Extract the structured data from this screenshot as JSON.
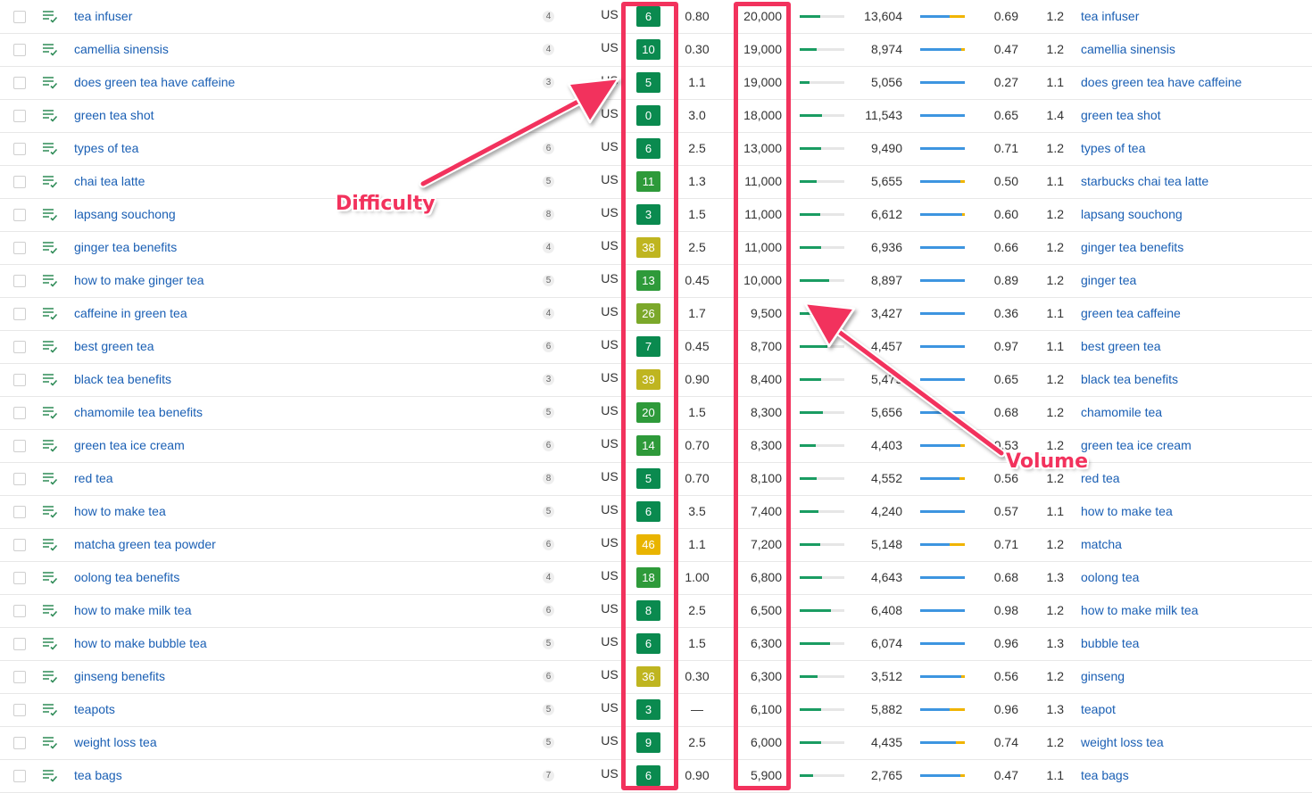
{
  "colors": {
    "link": "#1a5fb4",
    "annotation": "#f2325d",
    "kd_dark_green": "#0a8a4f",
    "kd_green": "#2e9a3a",
    "kd_light_green": "#7ba82a",
    "kd_olive": "#bfb520",
    "kd_yellow": "#e9b400",
    "volume_bar": "#1a9c62",
    "clicks_bar": "#3d95e0",
    "paid_clicks": "#f0b400"
  },
  "annotations": {
    "difficulty_label": "Difficulty",
    "volume_label": "Volume"
  },
  "rows": [
    {
      "keyword": "tea infuser",
      "sf": "4",
      "country": "US",
      "kd": "6",
      "kd_color": "#0a8a4f",
      "cpc": "0.80",
      "volume": "20,000",
      "vol_level": 0.45,
      "tp": "13,604",
      "paid_share": 0.35,
      "ctr": "0.69",
      "rr": "1.2",
      "parent": "tea infuser"
    },
    {
      "keyword": "camellia sinensis",
      "sf": "4",
      "country": "US",
      "kd": "10",
      "kd_color": "#0a8a4f",
      "cpc": "0.30",
      "volume": "19,000",
      "vol_level": 0.38,
      "tp": "8,974",
      "paid_share": 0.08,
      "ctr": "0.47",
      "rr": "1.2",
      "parent": "camellia sinensis"
    },
    {
      "keyword": "does green tea have caffeine",
      "sf": "3",
      "country": "US",
      "kd": "5",
      "kd_color": "#0a8a4f",
      "cpc": "1.1",
      "volume": "19,000",
      "vol_level": 0.22,
      "tp": "5,056",
      "paid_share": 0.0,
      "ctr": "0.27",
      "rr": "1.1",
      "parent": "does green tea have caffeine"
    },
    {
      "keyword": "green tea shot",
      "sf": "",
      "country": "US",
      "kd": "0",
      "kd_color": "#0a8a4f",
      "cpc": "3.0",
      "volume": "18,000",
      "vol_level": 0.5,
      "tp": "11,543",
      "paid_share": 0.0,
      "ctr": "0.65",
      "rr": "1.4",
      "parent": "green tea shot"
    },
    {
      "keyword": "types of tea",
      "sf": "6",
      "country": "US",
      "kd": "6",
      "kd_color": "#0a8a4f",
      "cpc": "2.5",
      "volume": "13,000",
      "vol_level": 0.48,
      "tp": "9,490",
      "paid_share": 0.0,
      "ctr": "0.71",
      "rr": "1.2",
      "parent": "types of tea"
    },
    {
      "keyword": "chai tea latte",
      "sf": "5",
      "country": "US",
      "kd": "11",
      "kd_color": "#2e9a3a",
      "cpc": "1.3",
      "volume": "11,000",
      "vol_level": 0.38,
      "tp": "5,655",
      "paid_share": 0.1,
      "ctr": "0.50",
      "rr": "1.1",
      "parent": "starbucks chai tea latte"
    },
    {
      "keyword": "lapsang souchong",
      "sf": "8",
      "country": "US",
      "kd": "3",
      "kd_color": "#0a8a4f",
      "cpc": "1.5",
      "volume": "11,000",
      "vol_level": 0.45,
      "tp": "6,612",
      "paid_share": 0.06,
      "ctr": "0.60",
      "rr": "1.2",
      "parent": "lapsang souchong"
    },
    {
      "keyword": "ginger tea benefits",
      "sf": "4",
      "country": "US",
      "kd": "38",
      "kd_color": "#bfb520",
      "cpc": "2.5",
      "volume": "11,000",
      "vol_level": 0.48,
      "tp": "6,936",
      "paid_share": 0.0,
      "ctr": "0.66",
      "rr": "1.2",
      "parent": "ginger tea benefits"
    },
    {
      "keyword": "how to make ginger tea",
      "sf": "5",
      "country": "US",
      "kd": "13",
      "kd_color": "#2e9a3a",
      "cpc": "0.45",
      "volume": "10,000",
      "vol_level": 0.66,
      "tp": "8,897",
      "paid_share": 0.0,
      "ctr": "0.89",
      "rr": "1.2",
      "parent": "ginger tea"
    },
    {
      "keyword": "caffeine in green tea",
      "sf": "4",
      "country": "US",
      "kd": "26",
      "kd_color": "#7ba82a",
      "cpc": "1.7",
      "volume": "9,500",
      "vol_level": 0.3,
      "tp": "3,427",
      "paid_share": 0.0,
      "ctr": "0.36",
      "rr": "1.1",
      "parent": "green tea caffeine"
    },
    {
      "keyword": "best green tea",
      "sf": "6",
      "country": "US",
      "kd": "7",
      "kd_color": "#0a8a4f",
      "cpc": "0.45",
      "volume": "8,700",
      "vol_level": 0.62,
      "tp": "4,457",
      "paid_share": 0.0,
      "ctr": "0.97",
      "rr": "1.1",
      "parent": "best green tea"
    },
    {
      "keyword": "black tea benefits",
      "sf": "3",
      "country": "US",
      "kd": "39",
      "kd_color": "#bfb520",
      "cpc": "0.90",
      "volume": "8,400",
      "vol_level": 0.48,
      "tp": "5,479",
      "paid_share": 0.0,
      "ctr": "0.65",
      "rr": "1.2",
      "parent": "black tea benefits"
    },
    {
      "keyword": "chamomile tea benefits",
      "sf": "5",
      "country": "US",
      "kd": "20",
      "kd_color": "#2e9a3a",
      "cpc": "1.5",
      "volume": "8,300",
      "vol_level": 0.52,
      "tp": "5,656",
      "paid_share": 0.0,
      "ctr": "0.68",
      "rr": "1.2",
      "parent": "chamomile tea"
    },
    {
      "keyword": "green tea ice cream",
      "sf": "6",
      "country": "US",
      "kd": "14",
      "kd_color": "#2e9a3a",
      "cpc": "0.70",
      "volume": "8,300",
      "vol_level": 0.36,
      "tp": "4,403",
      "paid_share": 0.1,
      "ctr": "0.53",
      "rr": "1.2",
      "parent": "green tea ice cream"
    },
    {
      "keyword": "red tea",
      "sf": "8",
      "country": "US",
      "kd": "5",
      "kd_color": "#0a8a4f",
      "cpc": "0.70",
      "volume": "8,100",
      "vol_level": 0.38,
      "tp": "4,552",
      "paid_share": 0.12,
      "ctr": "0.56",
      "rr": "1.2",
      "parent": "red tea"
    },
    {
      "keyword": "how to make tea",
      "sf": "5",
      "country": "US",
      "kd": "6",
      "kd_color": "#0a8a4f",
      "cpc": "3.5",
      "volume": "7,400",
      "vol_level": 0.42,
      "tp": "4,240",
      "paid_share": 0.0,
      "ctr": "0.57",
      "rr": "1.1",
      "parent": "how to make tea"
    },
    {
      "keyword": "matcha green tea powder",
      "sf": "6",
      "country": "US",
      "kd": "46",
      "kd_color": "#e9b400",
      "cpc": "1.1",
      "volume": "7,200",
      "vol_level": 0.46,
      "tp": "5,148",
      "paid_share": 0.35,
      "ctr": "0.71",
      "rr": "1.2",
      "parent": "matcha"
    },
    {
      "keyword": "oolong tea benefits",
      "sf": "4",
      "country": "US",
      "kd": "18",
      "kd_color": "#2e9a3a",
      "cpc": "1.00",
      "volume": "6,800",
      "vol_level": 0.5,
      "tp": "4,643",
      "paid_share": 0.0,
      "ctr": "0.68",
      "rr": "1.3",
      "parent": "oolong tea"
    },
    {
      "keyword": "how to make milk tea",
      "sf": "6",
      "country": "US",
      "kd": "8",
      "kd_color": "#0a8a4f",
      "cpc": "2.5",
      "volume": "6,500",
      "vol_level": 0.7,
      "tp": "6,408",
      "paid_share": 0.0,
      "ctr": "0.98",
      "rr": "1.2",
      "parent": "how to make milk tea"
    },
    {
      "keyword": "how to make bubble tea",
      "sf": "5",
      "country": "US",
      "kd": "6",
      "kd_color": "#0a8a4f",
      "cpc": "1.5",
      "volume": "6,300",
      "vol_level": 0.68,
      "tp": "6,074",
      "paid_share": 0.0,
      "ctr": "0.96",
      "rr": "1.3",
      "parent": "bubble tea"
    },
    {
      "keyword": "ginseng benefits",
      "sf": "6",
      "country": "US",
      "kd": "36",
      "kd_color": "#bfb520",
      "cpc": "0.30",
      "volume": "6,300",
      "vol_level": 0.4,
      "tp": "3,512",
      "paid_share": 0.08,
      "ctr": "0.56",
      "rr": "1.2",
      "parent": "ginseng"
    },
    {
      "keyword": "teapots",
      "sf": "5",
      "country": "US",
      "kd": "3",
      "kd_color": "#0a8a4f",
      "cpc": "—",
      "volume": "6,100",
      "vol_level": 0.48,
      "tp": "5,882",
      "paid_share": 0.35,
      "ctr": "0.96",
      "rr": "1.3",
      "parent": "teapot"
    },
    {
      "keyword": "weight loss tea",
      "sf": "5",
      "country": "US",
      "kd": "9",
      "kd_color": "#0a8a4f",
      "cpc": "2.5",
      "volume": "6,000",
      "vol_level": 0.48,
      "tp": "4,435",
      "paid_share": 0.2,
      "ctr": "0.74",
      "rr": "1.2",
      "parent": "weight loss tea"
    },
    {
      "keyword": "tea bags",
      "sf": "7",
      "country": "US",
      "kd": "6",
      "kd_color": "#0a8a4f",
      "cpc": "0.90",
      "volume": "5,900",
      "vol_level": 0.3,
      "tp": "2,765",
      "paid_share": 0.1,
      "ctr": "0.47",
      "rr": "1.1",
      "parent": "tea bags"
    }
  ]
}
